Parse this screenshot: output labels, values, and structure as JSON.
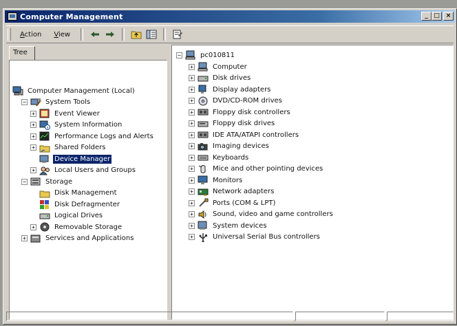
{
  "window": {
    "title": "Computer Management",
    "caption_buttons": [
      "minimize",
      "maximize",
      "close"
    ]
  },
  "menubar": {
    "action_label": "Action",
    "view_label": "View"
  },
  "toolbar": {
    "buttons": [
      "back-arrow-icon",
      "forward-arrow-icon",
      "up-folder-icon",
      "show-hide-tree-icon",
      "properties-icon"
    ]
  },
  "tree_tab": {
    "label": "Tree"
  },
  "tree": {
    "items": [
      {
        "label": "Computer Management (Local)",
        "expander": "",
        "icon": "computer-management-icon",
        "selected": false
      },
      {
        "label": "System Tools",
        "expander": "−",
        "icon": "system-tools-icon",
        "selected": false
      },
      {
        "label": "Event Viewer",
        "expander": "+",
        "icon": "event-viewer-icon",
        "selected": false
      },
      {
        "label": "System Information",
        "expander": "+",
        "icon": "system-information-icon",
        "selected": false
      },
      {
        "label": "Performance Logs and Alerts",
        "expander": "+",
        "icon": "performance-logs-icon",
        "selected": false
      },
      {
        "label": "Shared Folders",
        "expander": "+",
        "icon": "shared-folders-icon",
        "selected": false
      },
      {
        "label": "Device Manager",
        "expander": "",
        "icon": "device-manager-icon",
        "selected": true
      },
      {
        "label": "Local Users and Groups",
        "expander": "+",
        "icon": "local-users-icon",
        "selected": false
      },
      {
        "label": "Storage",
        "expander": "−",
        "icon": "storage-icon",
        "selected": false
      },
      {
        "label": "Disk Management",
        "expander": "",
        "icon": "disk-management-icon",
        "selected": false
      },
      {
        "label": "Disk Defragmenter",
        "expander": "",
        "icon": "disk-defragmenter-icon",
        "selected": false
      },
      {
        "label": "Logical Drives",
        "expander": "",
        "icon": "logical-drives-icon",
        "selected": false
      },
      {
        "label": "Removable Storage",
        "expander": "+",
        "icon": "removable-storage-icon",
        "selected": false
      },
      {
        "label": "Services and Applications",
        "expander": "+",
        "icon": "services-applications-icon",
        "selected": false
      }
    ]
  },
  "devices": {
    "root_label": "pc010811",
    "items": [
      {
        "label": "Computer",
        "icon": "computer-icon"
      },
      {
        "label": "Disk drives",
        "icon": "disk-drive-icon"
      },
      {
        "label": "Display adapters",
        "icon": "display-adapter-icon"
      },
      {
        "label": "DVD/CD-ROM drives",
        "icon": "cdrom-icon"
      },
      {
        "label": "Floppy disk controllers",
        "icon": "controller-icon"
      },
      {
        "label": "Floppy disk drives",
        "icon": "floppy-drive-icon"
      },
      {
        "label": "IDE ATA/ATAPI controllers",
        "icon": "controller-icon"
      },
      {
        "label": "Imaging devices",
        "icon": "camera-icon"
      },
      {
        "label": "Keyboards",
        "icon": "keyboard-icon"
      },
      {
        "label": "Mice and other pointing devices",
        "icon": "mouse-icon"
      },
      {
        "label": "Monitors",
        "icon": "monitor-icon"
      },
      {
        "label": "Network adapters",
        "icon": "network-adapter-icon"
      },
      {
        "label": "Ports (COM & LPT)",
        "icon": "port-icon"
      },
      {
        "label": "Sound, video and game controllers",
        "icon": "sound-icon"
      },
      {
        "label": "System devices",
        "icon": "system-device-icon"
      },
      {
        "label": "Universal Serial Bus controllers",
        "icon": "usb-icon"
      }
    ]
  },
  "colors": {
    "titlebar_start": "#0a246a",
    "titlebar_end": "#a6caf0",
    "selection": "#0a246a",
    "window_face": "#d4d0c8"
  }
}
